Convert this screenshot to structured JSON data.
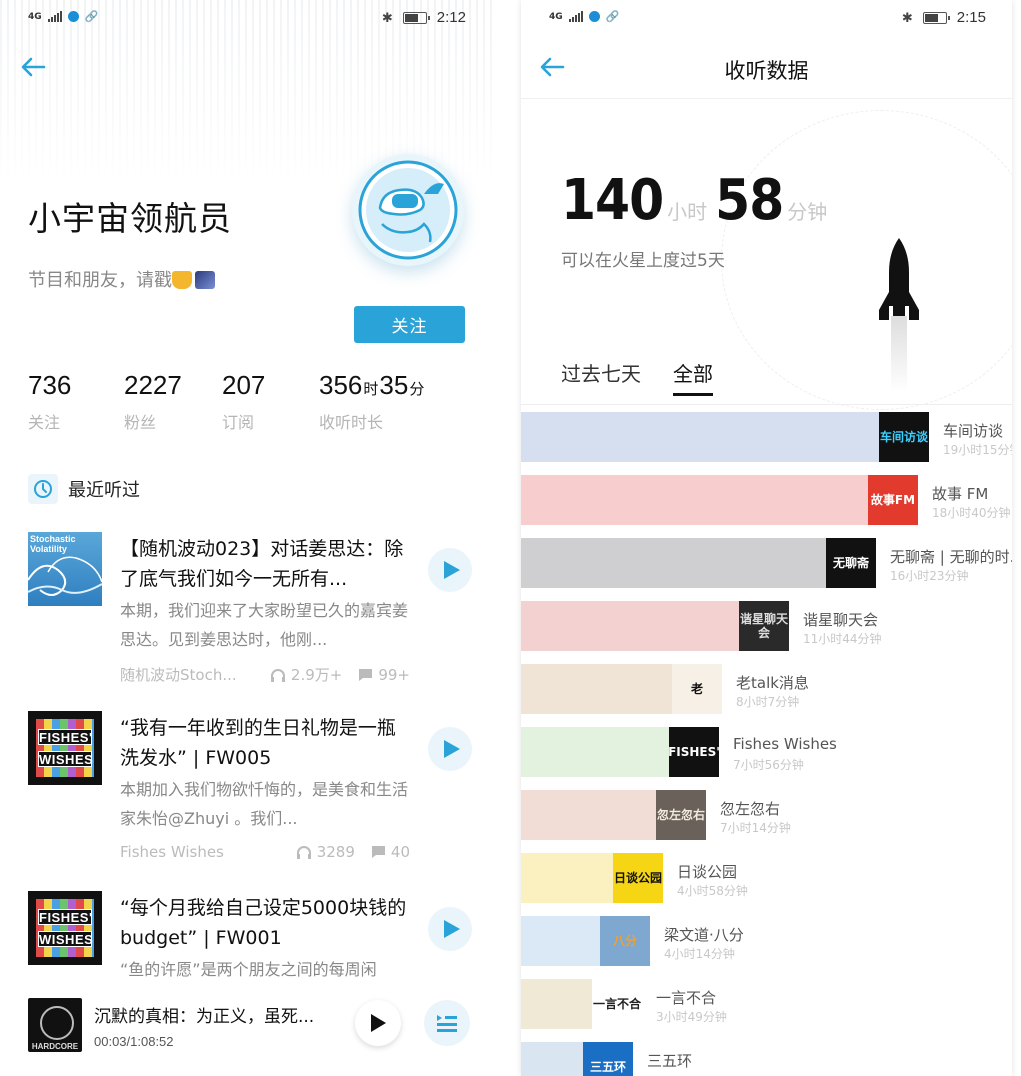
{
  "left": {
    "status": {
      "network": "4G",
      "time": "2:12"
    },
    "profile": {
      "name": "小宇宙领航员",
      "bio": "节目和朋友，请戳",
      "follow_label": "关注"
    },
    "stats": [
      {
        "value": "736",
        "label": "关注"
      },
      {
        "value": "2227",
        "label": "粉丝"
      },
      {
        "value": "207",
        "label": "订阅"
      }
    ],
    "listen_time": {
      "hours": "356",
      "hours_unit": "时",
      "minutes": "35",
      "minutes_unit": "分",
      "label": "收听时长"
    },
    "recent": {
      "title": "最近听过",
      "episodes": [
        {
          "cover_text": "Stochastic Volatility",
          "title": "【随机波动023】对话姜思达：除了底气我们如今一无所有...",
          "desc": "本期，我们迎来了大家盼望已久的嘉宾姜思达。见到姜思达时，他刚...",
          "podcast": "随机波动Stoch...",
          "plays": "2.9万+",
          "comments": "99+"
        },
        {
          "cover_text_top": "FISHES'",
          "cover_text_bottom": "WISHES",
          "title": "“我有一年收到的生日礼物是一瓶洗发水” | FW005",
          "desc": "本期加入我们物欲忏悔的，是美食和生活家朱怡@Zhuyi 。我们...",
          "podcast": "Fishes Wishes",
          "plays": "3289",
          "comments": "40"
        },
        {
          "cover_text_top": "FISHES'",
          "cover_text_bottom": "WISHES",
          "title": "“每个月我给自己设定5000块钱的budget” | FW001",
          "desc": "“鱼的许愿”是两个朋友之间的每周闲"
        }
      ]
    },
    "player": {
      "cover_text": "HARDCORE",
      "title": "沉默的真相：为正义，虽死...",
      "time": "00:03/1:08:52"
    }
  },
  "right": {
    "status": {
      "network": "4G",
      "time": "2:15"
    },
    "title": "收听数据",
    "total": {
      "hours": "140",
      "hours_unit": "小时",
      "minutes": "58",
      "minutes_unit": "分钟"
    },
    "mars_text": "可以在火星上度过5天",
    "tabs": [
      "过去七天",
      "全部"
    ],
    "active_tab": "全部",
    "ranking": [
      {
        "name": "车间访谈",
        "duration": "19小时15分钟",
        "thumb_text": "车间访谈",
        "color": "#d6dff0",
        "thumb_bg": "#111111",
        "thumb_fg": "#3ad0ff",
        "minutes": 1155
      },
      {
        "name": "故事 FM",
        "duration": "18小时40分钟",
        "thumb_text": "故事FM",
        "color": "#f8cdcd",
        "thumb_bg": "#e23b2e",
        "thumb_fg": "#ffffff",
        "minutes": 1120
      },
      {
        "name": "无聊斋 | 无聊的时...",
        "duration": "16小时23分钟",
        "thumb_text": "无聊斋",
        "color": "#cfcfd2",
        "thumb_bg": "#111111",
        "thumb_fg": "#ffffff",
        "minutes": 983
      },
      {
        "name": "谐星聊天会",
        "duration": "11小时44分钟",
        "thumb_text": "谐星聊天会",
        "color": "#f4d1d1",
        "thumb_bg": "#2a2a2a",
        "thumb_fg": "#dddddd",
        "minutes": 704
      },
      {
        "name": "老talk消息",
        "duration": "8小时7分钟",
        "thumb_text": "老",
        "color": "#efe4d6",
        "thumb_bg": "#f7f0e6",
        "thumb_fg": "#111111",
        "minutes": 487
      },
      {
        "name": "Fishes Wishes",
        "duration": "7小时56分钟",
        "thumb_text": "FISHES'",
        "color": "#e3f1df",
        "thumb_bg": "#111111",
        "thumb_fg": "#ffffff",
        "minutes": 476
      },
      {
        "name": "忽左忽右",
        "duration": "7小时14分钟",
        "thumb_text": "忽左忽右",
        "color": "#f1ddd5",
        "thumb_bg": "#6a625a",
        "thumb_fg": "#f0eadf",
        "minutes": 434
      },
      {
        "name": "日谈公园",
        "duration": "4小时58分钟",
        "thumb_text": "日谈公园",
        "color": "#fbf0c0",
        "thumb_bg": "#f5d514",
        "thumb_fg": "#111111",
        "minutes": 298
      },
      {
        "name": "梁文道·八分",
        "duration": "4小时14分钟",
        "thumb_text": "八分",
        "color": "#dbe8f5",
        "thumb_bg": "#7ea8cf",
        "thumb_fg": "#f2a030",
        "minutes": 254
      },
      {
        "name": "一言不合",
        "duration": "3小时49分钟",
        "thumb_text": "一言不合",
        "color": "#f0e9d6",
        "thumb_bg": "#ffffff",
        "thumb_fg": "#222222",
        "minutes": 229
      },
      {
        "name": "三五环",
        "duration": "",
        "thumb_text": "三五环",
        "color": "#d9e6f2",
        "thumb_bg": "#1a6fc4",
        "thumb_fg": "#ffffff",
        "minutes": 200
      }
    ]
  },
  "colors": {
    "accent": "#2aa3d8"
  },
  "icons": [
    "back-arrow-icon",
    "clock-icon",
    "play-icon",
    "headphones-icon",
    "comment-icon",
    "playlist-icon",
    "rocket-icon",
    "bluetooth-icon",
    "battery-icon",
    "signal-icon"
  ]
}
